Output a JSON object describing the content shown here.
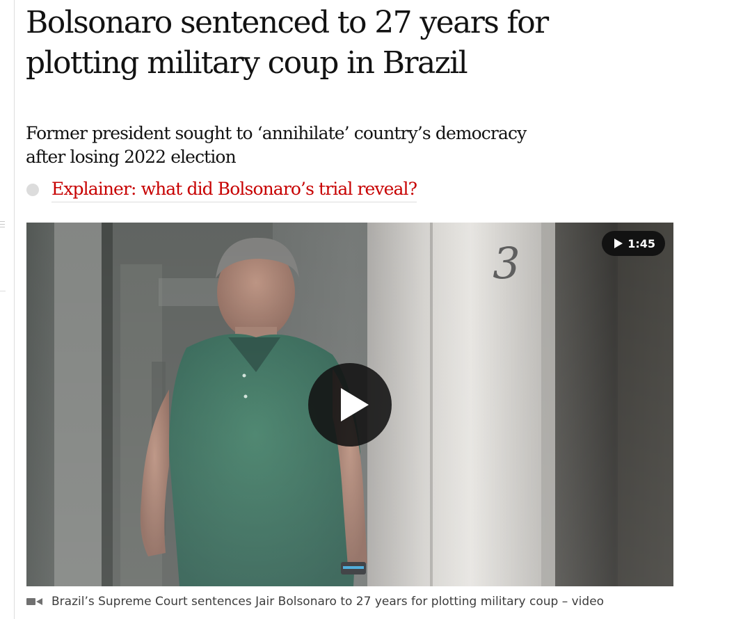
{
  "article": {
    "headline": "Bolsonaro sentenced to 27 years for plotting military coup in Brazil",
    "standfirst": "Former president sought to ‘annihilate’ country’s democracy after losing 2022 election",
    "related_link": "Explainer: what did Bolsonaro’s trial reveal?"
  },
  "video": {
    "duration": "1:45",
    "caption": "Brazil’s Supreme Court sentences Jair Bolsonaro to 27 years for plotting military coup – video",
    "door_number": "3"
  },
  "icons": {
    "duration": "play-icon",
    "main": "play-button-icon",
    "caption": "video-camera-icon",
    "related": "bullet-icon"
  },
  "colors": {
    "headline": "#121212",
    "link": "#c70000",
    "caption": "#3d3d3d",
    "overlay": "#121212"
  }
}
